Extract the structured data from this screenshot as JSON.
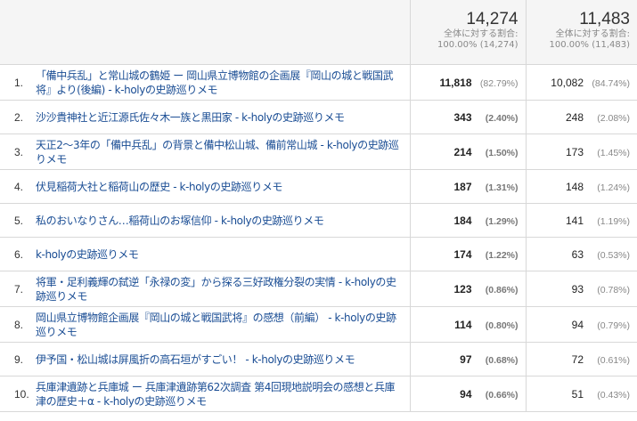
{
  "header": {
    "metric1": {
      "total": "14,274",
      "share_label": "全体に対する割合:",
      "share_value": "100.00% (14,274)"
    },
    "metric2": {
      "total": "11,483",
      "share_label": "全体に対する割合:",
      "share_value": "100.00% (11,483)"
    }
  },
  "rows": [
    {
      "index": "1.",
      "title": "「備中兵乱」と常山城の鶴姫 ー 岡山県立博物館の企画展『岡山の城と戦国武将』より(後編) - k-holyの史跡巡りメモ",
      "m1_value": "11,818",
      "m1_pct": "(82.79%)",
      "m2_value": "10,082",
      "m2_pct": "(84.74%)"
    },
    {
      "index": "2.",
      "title": "沙沙貴神社と近江源氏佐々木一族と黒田家 - k-holyの史跡巡りメモ",
      "m1_value": "343",
      "m1_pct": "(2.40%)",
      "m2_value": "248",
      "m2_pct": "(2.08%)"
    },
    {
      "index": "3.",
      "title": "天正2～3年の「備中兵乱」の背景と備中松山城、備前常山城 - k-holyの史跡巡りメモ",
      "m1_value": "214",
      "m1_pct": "(1.50%)",
      "m2_value": "173",
      "m2_pct": "(1.45%)"
    },
    {
      "index": "4.",
      "title": "伏見稲荷大社と稲荷山の歴史 - k-holyの史跡巡りメモ",
      "m1_value": "187",
      "m1_pct": "(1.31%)",
      "m2_value": "148",
      "m2_pct": "(1.24%)"
    },
    {
      "index": "5.",
      "title": "私のおいなりさん…稲荷山のお塚信仰 - k-holyの史跡巡りメモ",
      "m1_value": "184",
      "m1_pct": "(1.29%)",
      "m2_value": "141",
      "m2_pct": "(1.19%)"
    },
    {
      "index": "6.",
      "title": "k-holyの史跡巡りメモ",
      "m1_value": "174",
      "m1_pct": "(1.22%)",
      "m2_value": "63",
      "m2_pct": "(0.53%)"
    },
    {
      "index": "7.",
      "title": "将軍・足利義輝の弑逆「永禄の変」から探る三好政権分裂の実情 - k-holyの史跡巡りメモ",
      "m1_value": "123",
      "m1_pct": "(0.86%)",
      "m2_value": "93",
      "m2_pct": "(0.78%)"
    },
    {
      "index": "8.",
      "title": "岡山県立博物館企画展『岡山の城と戦国武将』の感想（前編） - k-holyの史跡巡りメモ",
      "m1_value": "114",
      "m1_pct": "(0.80%)",
      "m2_value": "94",
      "m2_pct": "(0.79%)"
    },
    {
      "index": "9.",
      "title": "伊予国・松山城は屏風折の高石垣がすごい！ - k-holyの史跡巡りメモ",
      "m1_value": "97",
      "m1_pct": "(0.68%)",
      "m2_value": "72",
      "m2_pct": "(0.61%)"
    },
    {
      "index": "10.",
      "title": "兵庫津遺跡と兵庫城 ー 兵庫津遺跡第62次調査 第4回現地説明会の感想と兵庫津の歴史＋α - k-holyの史跡巡りメモ",
      "m1_value": "94",
      "m1_pct": "(0.66%)",
      "m2_value": "51",
      "m2_pct": "(0.43%)"
    }
  ]
}
